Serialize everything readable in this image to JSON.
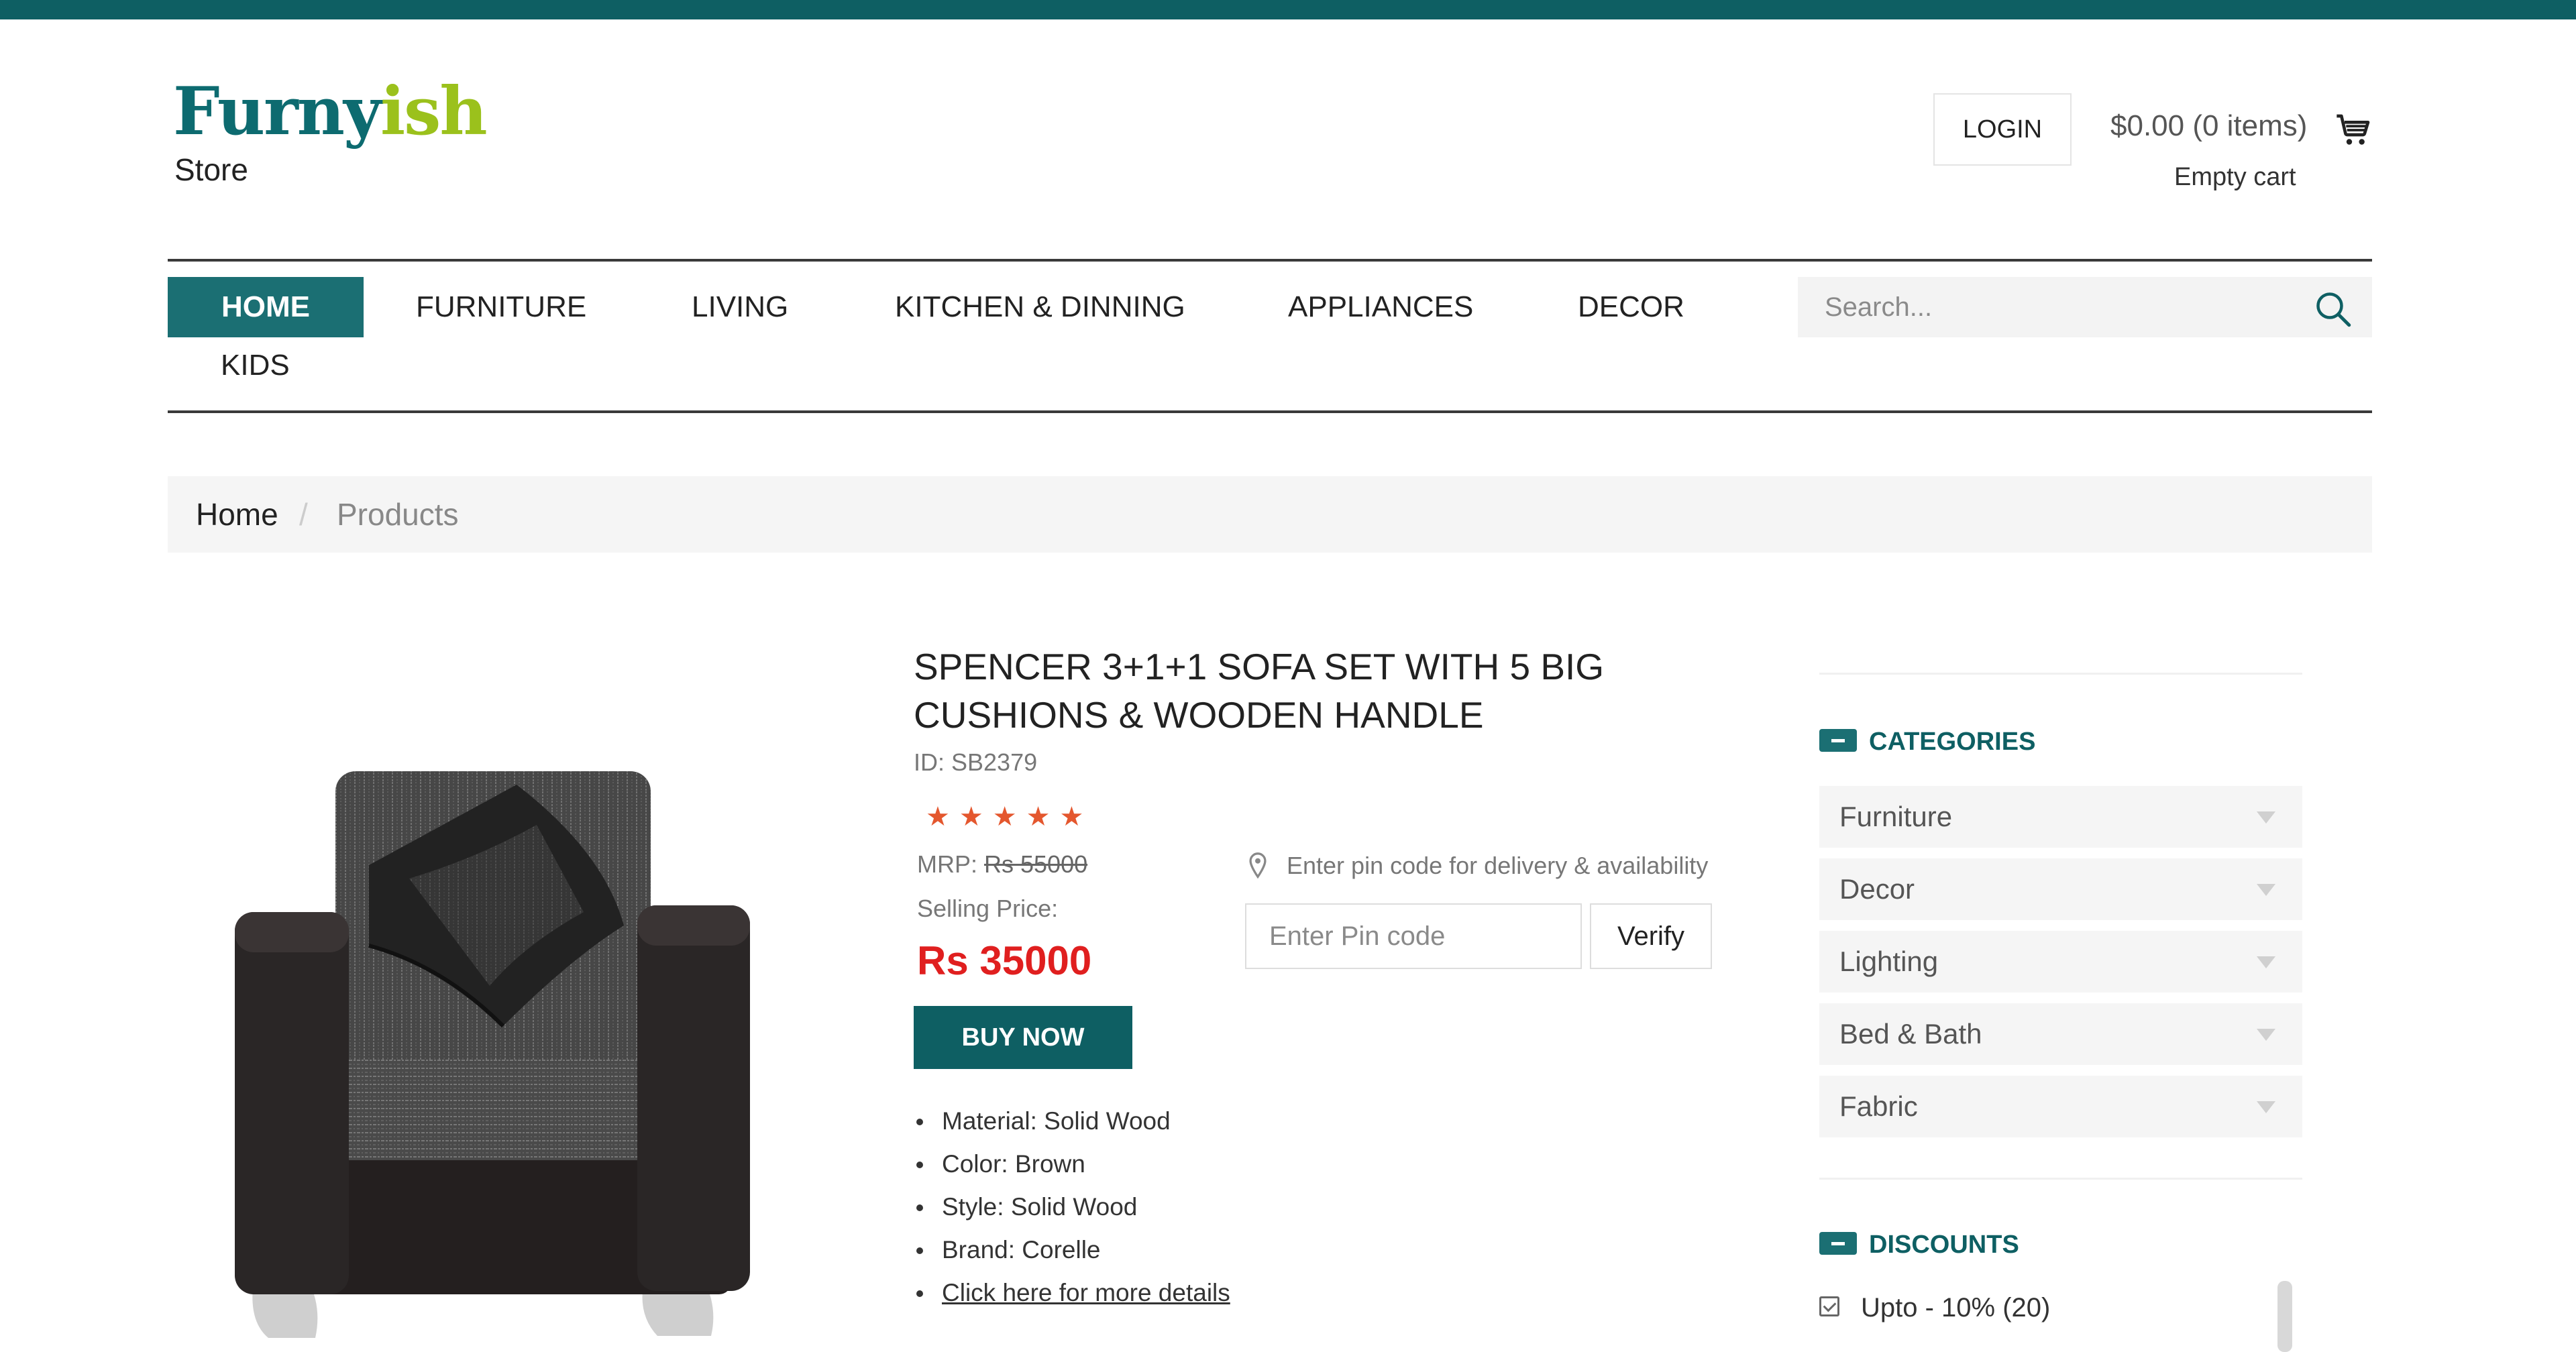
{
  "brand": {
    "logo_part1": "Furny",
    "logo_part2": "ish",
    "subtitle": "Store"
  },
  "header": {
    "login_label": "LOGIN",
    "cart_amount": "$0.00 (0 items)",
    "cart_status": "Empty cart"
  },
  "nav": {
    "items": [
      "HOME",
      "FURNITURE",
      "LIVING",
      "KITCHEN & DINNING",
      "APPLIANCES",
      "DECOR",
      "KIDS"
    ],
    "active": "HOME",
    "search_placeholder": "Search..."
  },
  "breadcrumb": {
    "home": "Home",
    "separator": "/",
    "current": "Products"
  },
  "product": {
    "title": "SPENCER 3+1+1 SOFA SET WITH 5 BIG CUSHIONS & WOODEN HANDLE",
    "id_label": "ID: SB2379",
    "rating": 5,
    "stars": "★★★★★",
    "mrp_label": "MRP:",
    "mrp_value": "Rs 55000",
    "selling_label": "Selling Price:",
    "selling_price": "Rs 35000",
    "buy_label": "BUY NOW",
    "specs": [
      "Material: Solid Wood",
      "Color: Brown",
      "Style: Solid Wood",
      "Brand: Corelle"
    ],
    "details_link": "Click here for more details"
  },
  "delivery": {
    "note": "Enter pin code for delivery & availability",
    "pin_placeholder": "Enter Pin code",
    "verify_label": "Verify"
  },
  "sidebar": {
    "categories_title": "CATEGORIES",
    "categories": [
      "Furniture",
      "Decor",
      "Lighting",
      "Bed & Bath",
      "Fabric"
    ],
    "discounts_title": "DISCOUNTS",
    "discounts": [
      {
        "label": "Upto - 10% (20)",
        "checked": true
      }
    ]
  },
  "colors": {
    "brand_teal": "#0e5f63",
    "accent_green": "#9bc11c",
    "price_red": "#e01f1f",
    "star_orange": "#e4572e"
  },
  "icons": [
    "cart-icon",
    "search-icon",
    "location-pin-icon",
    "collapse-minus-icon",
    "chevron-down-icon",
    "checkbox-checked-icon"
  ]
}
